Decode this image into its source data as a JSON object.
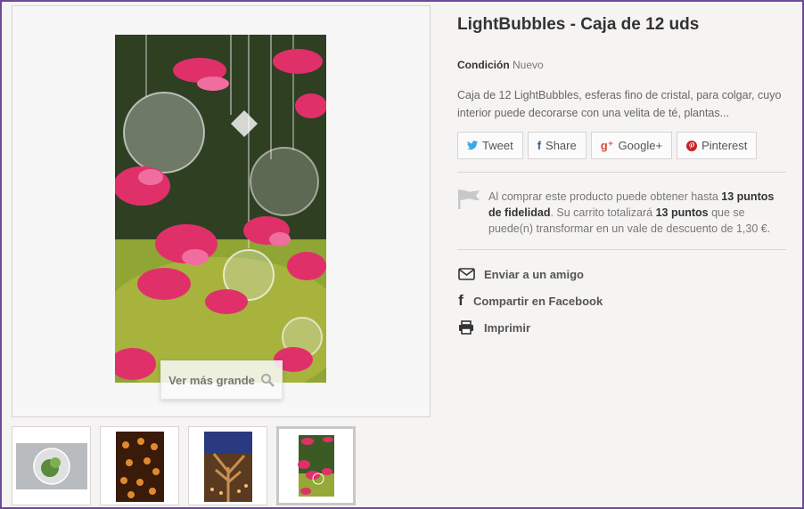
{
  "product": {
    "title": "LightBubbles - Caja de 12 uds",
    "condition_label": "Condición",
    "condition_value": "Nuevo",
    "description": "Caja de 12 LightBubbles, esferas fino de cristal, para colgar, cuyo interior puede decorarse con una velita de té, plantas..."
  },
  "image": {
    "zoom_label": "Ver más grande",
    "zoom_icon": "magnifier-icon"
  },
  "thumbnails": [
    {
      "name": "thumbnail-1"
    },
    {
      "name": "thumbnail-2"
    },
    {
      "name": "thumbnail-3"
    },
    {
      "name": "thumbnail-4",
      "active": true
    }
  ],
  "share": {
    "tweet": "Tweet",
    "share": "Share",
    "google": "Google+",
    "pinterest": "Pinterest"
  },
  "loyalty": {
    "text_1": "Al comprar este producto puede obtener hasta ",
    "points_1": "13 puntos de fidelidad",
    "text_2": ". Su carrito totalizará ",
    "points_2": "13 puntos",
    "text_3": " que se puede(n) transformar en un vale de descuento de 1,30 €."
  },
  "links": {
    "send_friend": "Enviar a un amigo",
    "share_facebook": "Compartir en Facebook",
    "print": "Imprimir"
  },
  "colors": {
    "twitter": "#3ba9e0",
    "facebook": "#3b5a9a",
    "google": "#d94a38",
    "pinterest": "#cb2027",
    "frame": "#6c4a9a"
  }
}
